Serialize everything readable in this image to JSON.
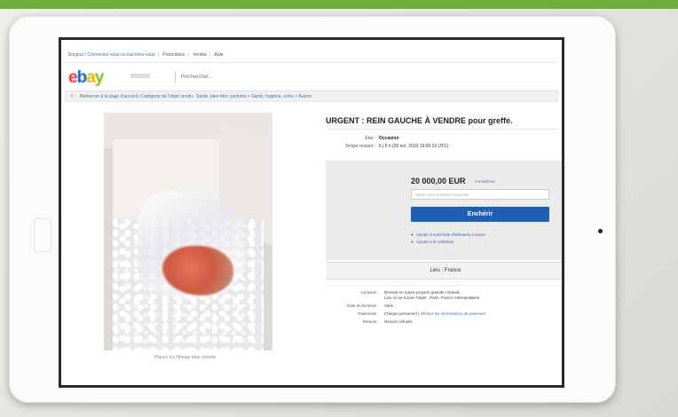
{
  "top_nav": [
    "Bonjour ! Connectez-vous ou inscrivez-vous",
    "Promotions",
    "Vendre",
    "Aide"
  ],
  "logo": {
    "letters": [
      "e",
      "b",
      "a",
      "y"
    ],
    "colors": [
      "#e53238",
      "#0064d2",
      "#f5af02",
      "#86b817"
    ]
  },
  "search": {
    "placeholder": "Rechercher..."
  },
  "breadcrumb": {
    "back_label": "Retourner à la page d'accueil",
    "path": "Catégorie de l'objet vendu : Santé, bien-être, parfums > Santé, hygiène, soins > Autres"
  },
  "listing": {
    "title": "URGENT : REIN GAUCHE À VENDRE pour greffe.",
    "condition_label": "État :",
    "condition_value": "Occasion",
    "time_label": "Temps restant :",
    "time_value": "6 j 5 h (20 oct. 2019 19:00:19 UTC)",
    "price": "20 000,00 EUR",
    "price_note": "3 enchères",
    "bid_placeholder": "Saisir votre enchère maximale",
    "bid_button": "Enchérir",
    "link_watchlist": "Ajouter à votre liste d'éléments à suivre",
    "link_collection": "Ajouter à la collection",
    "location_bar": "Lieu : France"
  },
  "photo_caption": "Placez sur l'image pour zoomer",
  "details": [
    {
      "label": "Livraison :",
      "value": "Remise en mains propres gratuite | Détails",
      "extra": "Lieu où se trouve l'objet : Paris, France métropolitaine"
    },
    {
      "label": "Date de livraison :",
      "value": "Varie"
    },
    {
      "label": "Paiements :",
      "value": "Chèque personnel |",
      "link": "Afficher les informations de paiement"
    },
    {
      "label": "Retours :",
      "value": "Retours refusés"
    }
  ],
  "colors": {
    "bid_button": "#1f5fb5",
    "link": "#4a6ea8",
    "top_band": "#6fae3c"
  }
}
